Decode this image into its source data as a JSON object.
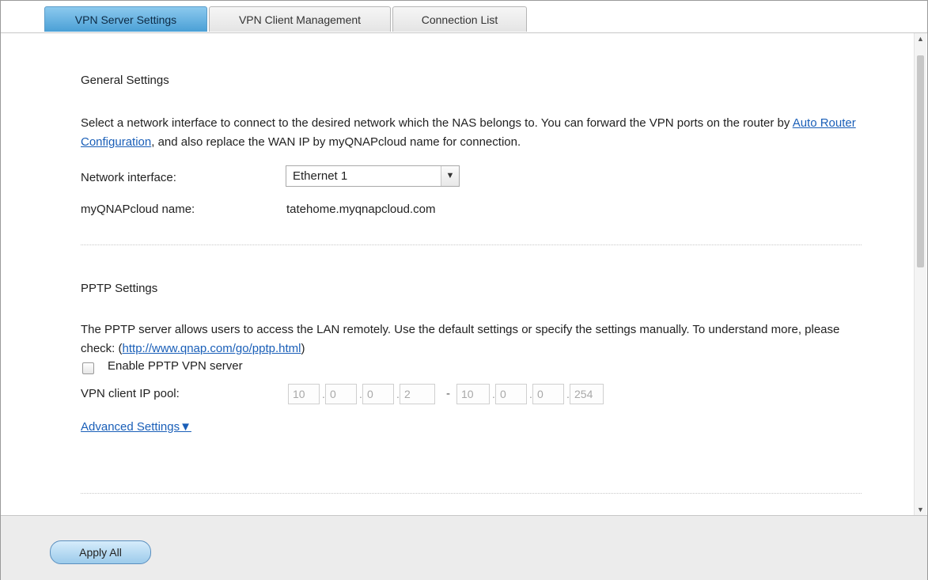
{
  "tabs": [
    {
      "label": "VPN Server Settings"
    },
    {
      "label": "VPN Client Management"
    },
    {
      "label": "Connection List"
    }
  ],
  "general": {
    "title": "General Settings",
    "desc_part1": "Select a network interface to connect to the desired network which the NAS belongs to. You can forward the VPN ports on the router by ",
    "desc_link": "Auto Router Configuration",
    "desc_part2": ", and also replace the WAN IP by myQNAPcloud name for connection.",
    "network_interface_label": "Network interface:",
    "network_interface_value": "Ethernet 1",
    "cloud_name_label": "myQNAPcloud name:",
    "cloud_name_value": "tatehome.myqnapcloud.com"
  },
  "pptp": {
    "title": "PPTP Settings",
    "desc_part1": "The PPTP server allows users to access the LAN remotely. Use the default settings or specify the settings manually. To understand more, please check: (",
    "desc_link": "http://www.qnap.com/go/pptp.html",
    "desc_part2": ")",
    "enable_label": "Enable PPTP VPN server",
    "enable_checked": false,
    "ip_pool_label": "VPN client IP pool:",
    "ip_start": [
      "10",
      "0",
      "0",
      "2"
    ],
    "ip_end": [
      "10",
      "0",
      "0",
      "254"
    ],
    "ip_separator": "-",
    "advanced_label": "Advanced Settings▼"
  },
  "footer": {
    "apply_label": "Apply All"
  },
  "icons": {
    "dropdown": "chevron-down-icon",
    "scroll_up": "scroll-up-icon",
    "scroll_down": "scroll-down-icon"
  },
  "colors": {
    "active_tab": "#4aa0d6",
    "link": "#1a5fb8",
    "apply_button": "#9ccbeb"
  }
}
